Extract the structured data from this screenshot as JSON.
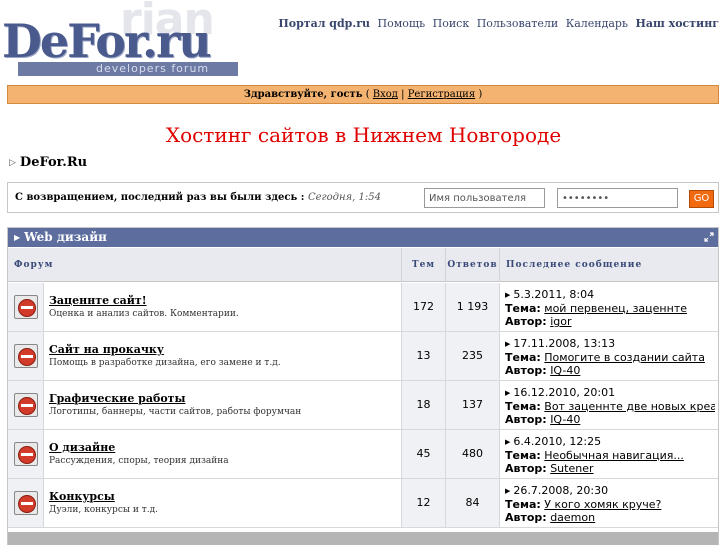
{
  "logo": {
    "main": "DeFor.ru",
    "background_text": "rian",
    "subtitle": "developers forum"
  },
  "topnav": {
    "items": [
      "Портал qdp.ru",
      "Помощь",
      "Поиск",
      "Пользователи",
      "Календарь",
      "Наш хостинг"
    ]
  },
  "greeting": {
    "text": "Здравствуйте, гость",
    "open": "(",
    "login": "Вход",
    "sep": "|",
    "register": "Регистрация",
    "close": ")"
  },
  "ad_title": "Хостинг сайтов в Нижнем Новгороде",
  "breadcrumb": "DeFor.Ru",
  "login_box": {
    "welcome": "С возвращением, последний раз вы были здесь :",
    "last_visit": "Сегодня, 1:54",
    "username_value": "Имя пользователя",
    "password_value": "••••••••",
    "go_label": "GO"
  },
  "category": {
    "title": "Web дизайн"
  },
  "columns": {
    "forum": "Форум",
    "topics": "Тем",
    "replies": "Ответов",
    "last_post": "Последнее сообщение"
  },
  "labels": {
    "topic": "Тема:",
    "author": "Автор:"
  },
  "forums": [
    {
      "title": "Заценнте сайт!",
      "desc": "Оценка и анализ сайтов. Комментарии.",
      "topics": "172",
      "replies": "1 193",
      "date": "5.3.2011, 8:04",
      "topic": "мой первенец, заценнте",
      "author": "igor"
    },
    {
      "title": "Сайт на прокачку",
      "desc": "Помощь в разработке дизайна, его замене и т.д.",
      "topics": "13",
      "replies": "235",
      "date": "17.11.2008, 13:13",
      "topic": "Помогите в создании сайта",
      "author": "IQ-40"
    },
    {
      "title": "Графические работы",
      "desc": "Логотипы, баннеры, части сайтов, работы форумчан",
      "topics": "18",
      "replies": "137",
      "date": "16.12.2010, 20:01",
      "topic": "Вот заценнте две новых креа...",
      "author": "IQ-40"
    },
    {
      "title": "О дизайне",
      "desc": "Рассуждения, споры, теория дизайна",
      "topics": "45",
      "replies": "480",
      "date": "6.4.2010, 12:25",
      "topic": "Необычная навигация...",
      "author": "Sutener"
    },
    {
      "title": "Конкурсы",
      "desc": "Дуэли, конкурсы и т.д.",
      "topics": "12",
      "replies": "84",
      "date": "26.7.2008, 20:30",
      "topic": "У кого хомяк круче?",
      "author": "daemon"
    }
  ],
  "colors": {
    "header_bar": "#5d6d9e",
    "greet_bar": "#f4b370",
    "ad_title": "#e00000",
    "go_button": "#f26a10"
  }
}
